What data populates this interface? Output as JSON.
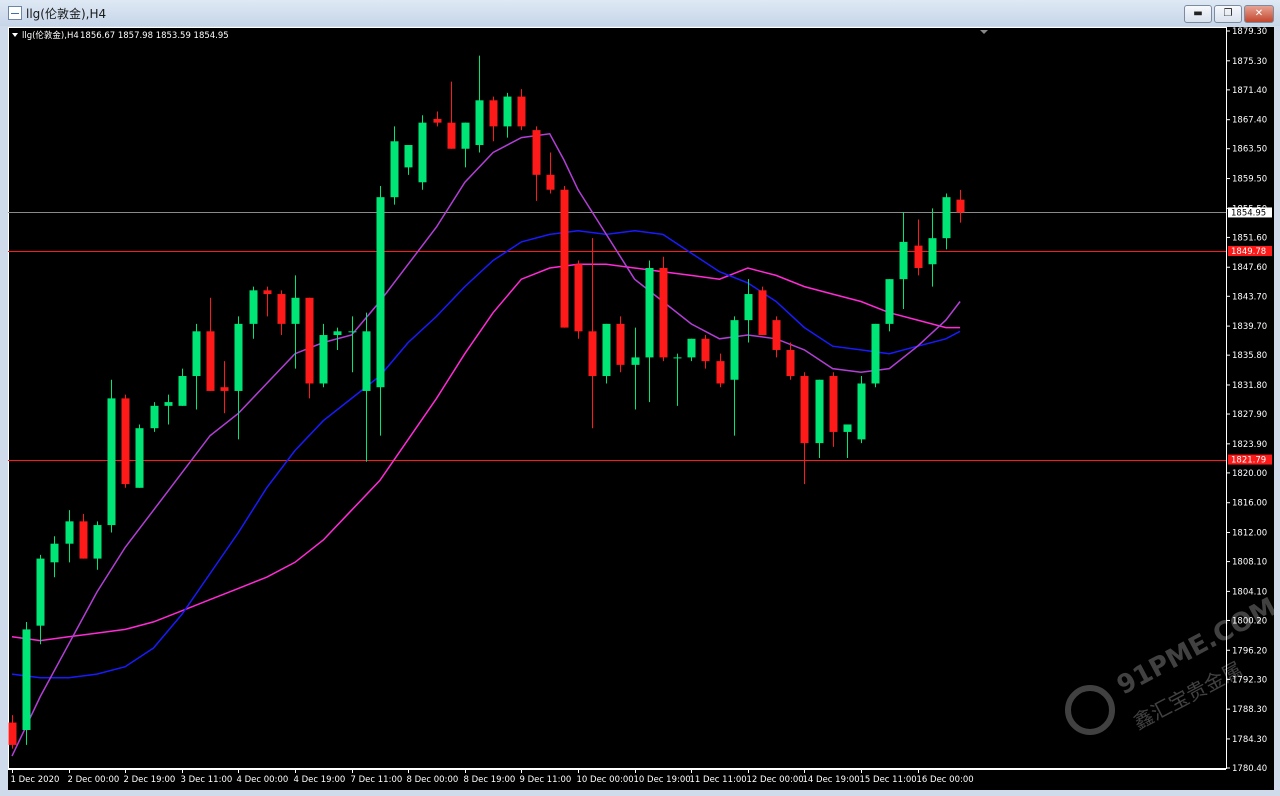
{
  "window": {
    "title": "llg(伦敦金),H4",
    "minimize_glyph": "▬",
    "restore_glyph": "❐",
    "close_glyph": "✕"
  },
  "chart": {
    "header_label": "llg(伦敦金),H4",
    "ohlc_text": "1856.67 1857.98 1853.59 1854.95",
    "watermark_brand": "91PME.COM",
    "watermark_cn": "鑫汇宝贵金属",
    "colors": {
      "background": "#000000",
      "bull": "#00e676",
      "bear": "#ff1a1a",
      "ma_fast": "#b23fd6",
      "ma_mid": "#1a1aff",
      "ma_slow": "#ff2bd6",
      "level_line": "#ff1a1a",
      "price_line": "#8a8a8a",
      "axis_text": "#ffffff"
    }
  },
  "chart_data": {
    "type": "candlestick",
    "title": "llg(伦敦金),H4",
    "ylim": [
      1780.4,
      1879.3
    ],
    "y_ticks": [
      "1879.30",
      "1875.30",
      "1871.40",
      "1867.40",
      "1863.50",
      "1859.50",
      "1855.50",
      "1851.60",
      "1847.60",
      "1843.70",
      "1839.70",
      "1835.80",
      "1831.80",
      "1827.90",
      "1823.90",
      "1820.00",
      "1816.00",
      "1812.00",
      "1808.10",
      "1804.10",
      "1800.20",
      "1796.20",
      "1792.30",
      "1788.30",
      "1784.30",
      "1780.40"
    ],
    "x_labels": [
      {
        "i": 0,
        "label": "1 Dec 2020"
      },
      {
        "i": 4,
        "label": "2 Dec 00:00"
      },
      {
        "i": 8,
        "label": "2 Dec 19:00"
      },
      {
        "i": 12,
        "label": "3 Dec 11:00"
      },
      {
        "i": 16,
        "label": "4 Dec 00:00"
      },
      {
        "i": 20,
        "label": "4 Dec 19:00"
      },
      {
        "i": 24,
        "label": "7 Dec 11:00"
      },
      {
        "i": 28,
        "label": "8 Dec 00:00"
      },
      {
        "i": 32,
        "label": "8 Dec 19:00"
      },
      {
        "i": 36,
        "label": "9 Dec 11:00"
      },
      {
        "i": 40,
        "label": "10 Dec 00:00"
      },
      {
        "i": 44,
        "label": "10 Dec 19:00"
      },
      {
        "i": 48,
        "label": "11 Dec 11:00"
      },
      {
        "i": 52,
        "label": "12 Dec 00:00"
      },
      {
        "i": 56,
        "label": "14 Dec 19:00"
      },
      {
        "i": 60,
        "label": "15 Dec 11:00"
      },
      {
        "i": 64,
        "label": "16 Dec 00:00"
      }
    ],
    "levels": [
      {
        "price": 1849.78,
        "label": "1849.78"
      },
      {
        "price": 1821.79,
        "label": "1821.79"
      }
    ],
    "current_price": {
      "price": 1854.95,
      "label": "1854.95"
    },
    "candles": [
      [
        1786.5,
        1787.5,
        1783.0,
        1783.5
      ],
      [
        1785.5,
        1800.0,
        1783.5,
        1799.0
      ],
      [
        1799.5,
        1809.0,
        1797.0,
        1808.5
      ],
      [
        1808.0,
        1811.5,
        1806.0,
        1810.5
      ],
      [
        1810.5,
        1815.0,
        1808.0,
        1813.5
      ],
      [
        1813.5,
        1814.5,
        1808.5,
        1808.5
      ],
      [
        1808.5,
        1813.5,
        1807.0,
        1813.0
      ],
      [
        1813.0,
        1832.5,
        1812.0,
        1830.0
      ],
      [
        1830.0,
        1830.5,
        1818.0,
        1818.5
      ],
      [
        1818.0,
        1826.5,
        1818.0,
        1826.0
      ],
      [
        1826.0,
        1829.5,
        1825.5,
        1829.0
      ],
      [
        1829.0,
        1830.5,
        1826.5,
        1829.5
      ],
      [
        1829.0,
        1834.0,
        1829.0,
        1833.0
      ],
      [
        1833.0,
        1840.0,
        1828.5,
        1839.0
      ],
      [
        1839.0,
        1843.5,
        1831.0,
        1831.0
      ],
      [
        1831.5,
        1835.0,
        1828.0,
        1831.0
      ],
      [
        1831.0,
        1841.0,
        1824.5,
        1840.0
      ],
      [
        1840.0,
        1845.0,
        1838.0,
        1844.5
      ],
      [
        1844.5,
        1845.0,
        1841.0,
        1844.0
      ],
      [
        1844.0,
        1844.5,
        1838.5,
        1840.0
      ],
      [
        1840.0,
        1846.5,
        1834.0,
        1843.5
      ],
      [
        1843.5,
        1843.5,
        1830.0,
        1832.0
      ],
      [
        1832.0,
        1840.0,
        1831.5,
        1838.5
      ],
      [
        1838.5,
        1839.5,
        1836.5,
        1839.0
      ],
      [
        1839.0,
        1841.0,
        1833.5,
        1839.0
      ],
      [
        1831.0,
        1841.5,
        1821.5,
        1839.0
      ],
      [
        1831.5,
        1858.5,
        1825.0,
        1857.0
      ],
      [
        1857.0,
        1866.5,
        1856.0,
        1864.5
      ],
      [
        1861.0,
        1864.0,
        1860.0,
        1864.0
      ],
      [
        1859.0,
        1868.0,
        1858.0,
        1867.0
      ],
      [
        1867.5,
        1868.5,
        1866.5,
        1867.0
      ],
      [
        1867.0,
        1872.5,
        1863.5,
        1863.5
      ],
      [
        1863.5,
        1867.0,
        1861.0,
        1867.0
      ],
      [
        1864.0,
        1876.0,
        1863.0,
        1870.0
      ],
      [
        1870.0,
        1870.5,
        1864.5,
        1866.5
      ],
      [
        1866.5,
        1871.0,
        1865.0,
        1870.5
      ],
      [
        1870.5,
        1871.5,
        1866.0,
        1866.5
      ],
      [
        1866.0,
        1866.5,
        1856.5,
        1860.0
      ],
      [
        1860.0,
        1863.0,
        1857.5,
        1858.0
      ],
      [
        1858.0,
        1858.5,
        1839.5,
        1839.5
      ],
      [
        1848.0,
        1848.5,
        1838.0,
        1839.0
      ],
      [
        1839.0,
        1851.5,
        1826.0,
        1833.0
      ],
      [
        1833.0,
        1840.0,
        1832.0,
        1840.0
      ],
      [
        1840.0,
        1841.0,
        1833.5,
        1834.5
      ],
      [
        1834.5,
        1839.5,
        1828.5,
        1835.5
      ],
      [
        1835.5,
        1848.5,
        1829.5,
        1847.5
      ],
      [
        1847.5,
        1849.0,
        1835.0,
        1835.5
      ],
      [
        1835.5,
        1836.0,
        1829.0,
        1835.5
      ],
      [
        1835.5,
        1838.0,
        1835.0,
        1838.0
      ],
      [
        1838.0,
        1838.5,
        1834.0,
        1835.0
      ],
      [
        1835.0,
        1836.0,
        1831.5,
        1832.0
      ],
      [
        1832.5,
        1841.0,
        1825.0,
        1840.5
      ],
      [
        1840.5,
        1846.0,
        1837.5,
        1844.0
      ],
      [
        1844.5,
        1845.0,
        1838.5,
        1838.5
      ],
      [
        1840.5,
        1841.0,
        1835.5,
        1836.5
      ],
      [
        1836.5,
        1837.5,
        1832.5,
        1833.0
      ],
      [
        1833.0,
        1833.5,
        1818.5,
        1824.0
      ],
      [
        1824.0,
        1832.5,
        1822.0,
        1832.5
      ],
      [
        1833.0,
        1833.5,
        1823.5,
        1825.5
      ],
      [
        1825.5,
        1826.5,
        1822.0,
        1826.5
      ],
      [
        1824.5,
        1833.0,
        1824.0,
        1832.0
      ],
      [
        1832.0,
        1840.0,
        1831.5,
        1840.0
      ],
      [
        1840.0,
        1846.0,
        1839.0,
        1846.0
      ],
      [
        1846.0,
        1855.0,
        1842.0,
        1851.0
      ],
      [
        1850.5,
        1854.0,
        1846.5,
        1847.5
      ],
      [
        1848.0,
        1855.5,
        1845.0,
        1851.5
      ],
      [
        1851.5,
        1857.5,
        1850.0,
        1857.0
      ],
      [
        1856.67,
        1857.98,
        1853.59,
        1854.95
      ]
    ],
    "ma_fast": [
      [
        0,
        1782.0
      ],
      [
        2,
        1790.0
      ],
      [
        4,
        1797.0
      ],
      [
        6,
        1804.0
      ],
      [
        8,
        1810.0
      ],
      [
        10,
        1815.0
      ],
      [
        12,
        1820.0
      ],
      [
        14,
        1825.0
      ],
      [
        16,
        1828.0
      ],
      [
        18,
        1832.0
      ],
      [
        20,
        1836.0
      ],
      [
        22,
        1837.5
      ],
      [
        24,
        1838.5
      ],
      [
        26,
        1843.0
      ],
      [
        28,
        1848.0
      ],
      [
        30,
        1853.0
      ],
      [
        32,
        1859.0
      ],
      [
        34,
        1863.0
      ],
      [
        36,
        1865.0
      ],
      [
        38,
        1865.5
      ],
      [
        39,
        1862.0
      ],
      [
        40,
        1858.0
      ],
      [
        42,
        1852.0
      ],
      [
        44,
        1846.0
      ],
      [
        46,
        1843.0
      ],
      [
        48,
        1840.0
      ],
      [
        50,
        1838.0
      ],
      [
        52,
        1838.5
      ],
      [
        54,
        1838.0
      ],
      [
        56,
        1836.5
      ],
      [
        58,
        1834.0
      ],
      [
        60,
        1833.5
      ],
      [
        62,
        1834.0
      ],
      [
        64,
        1837.0
      ],
      [
        66,
        1840.5
      ],
      [
        67,
        1843.0
      ]
    ],
    "ma_mid": [
      [
        0,
        1793.0
      ],
      [
        2,
        1792.5
      ],
      [
        4,
        1792.5
      ],
      [
        6,
        1793.0
      ],
      [
        8,
        1794.0
      ],
      [
        10,
        1796.5
      ],
      [
        12,
        1801.0
      ],
      [
        14,
        1806.5
      ],
      [
        16,
        1812.0
      ],
      [
        18,
        1818.0
      ],
      [
        20,
        1823.0
      ],
      [
        22,
        1827.0
      ],
      [
        24,
        1830.0
      ],
      [
        26,
        1833.0
      ],
      [
        28,
        1837.5
      ],
      [
        30,
        1841.0
      ],
      [
        32,
        1845.0
      ],
      [
        34,
        1848.5
      ],
      [
        36,
        1851.0
      ],
      [
        38,
        1852.0
      ],
      [
        40,
        1852.5
      ],
      [
        42,
        1852.0
      ],
      [
        44,
        1852.5
      ],
      [
        46,
        1852.0
      ],
      [
        48,
        1849.5
      ],
      [
        50,
        1847.0
      ],
      [
        52,
        1845.5
      ],
      [
        54,
        1843.0
      ],
      [
        56,
        1839.5
      ],
      [
        58,
        1837.0
      ],
      [
        60,
        1836.5
      ],
      [
        62,
        1836.0
      ],
      [
        64,
        1837.0
      ],
      [
        66,
        1838.0
      ],
      [
        67,
        1839.0
      ]
    ],
    "ma_slow": [
      [
        0,
        1798.0
      ],
      [
        2,
        1797.5
      ],
      [
        4,
        1798.0
      ],
      [
        6,
        1798.5
      ],
      [
        8,
        1799.0
      ],
      [
        10,
        1800.0
      ],
      [
        12,
        1801.5
      ],
      [
        14,
        1803.0
      ],
      [
        16,
        1804.5
      ],
      [
        18,
        1806.0
      ],
      [
        20,
        1808.0
      ],
      [
        22,
        1811.0
      ],
      [
        24,
        1815.0
      ],
      [
        26,
        1819.0
      ],
      [
        28,
        1824.5
      ],
      [
        30,
        1830.0
      ],
      [
        32,
        1836.0
      ],
      [
        34,
        1841.5
      ],
      [
        36,
        1846.0
      ],
      [
        38,
        1847.5
      ],
      [
        40,
        1848.0
      ],
      [
        42,
        1848.0
      ],
      [
        44,
        1847.5
      ],
      [
        46,
        1847.0
      ],
      [
        48,
        1846.5
      ],
      [
        50,
        1846.0
      ],
      [
        52,
        1847.5
      ],
      [
        54,
        1846.5
      ],
      [
        56,
        1845.0
      ],
      [
        58,
        1844.0
      ],
      [
        60,
        1843.0
      ],
      [
        62,
        1841.5
      ],
      [
        64,
        1840.5
      ],
      [
        66,
        1839.5
      ],
      [
        67,
        1839.5
      ]
    ]
  }
}
